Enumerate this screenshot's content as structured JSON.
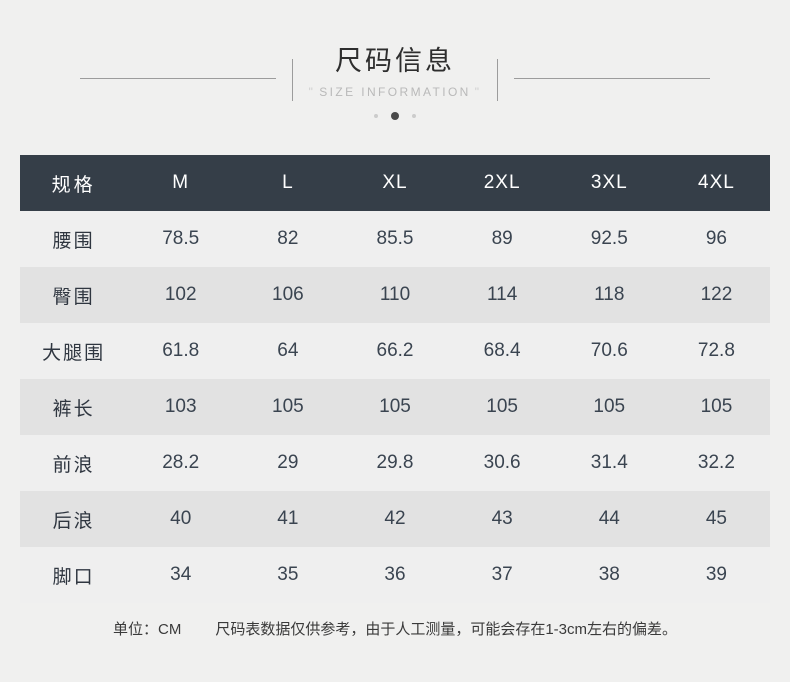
{
  "header": {
    "title": "尺码信息",
    "subtitle": "SIZE INFORMATION",
    "quote_open": "\"",
    "quote_close": "\"",
    "accent_color": "#353e48",
    "rule_color": "#9c9c9c",
    "dots": [
      {
        "name": "carousel-dot-1",
        "active": false
      },
      {
        "name": "carousel-dot-2",
        "active": true
      },
      {
        "name": "carousel-dot-3",
        "active": false
      }
    ]
  },
  "table": {
    "columns": [
      "规格",
      "M",
      "L",
      "XL",
      "2XL",
      "3XL",
      "4XL"
    ],
    "rows": [
      {
        "label": "腰围",
        "values": [
          "78.5",
          "82",
          "85.5",
          "89",
          "92.5",
          "96"
        ]
      },
      {
        "label": "臀围",
        "values": [
          "102",
          "106",
          "110",
          "114",
          "118",
          "122"
        ]
      },
      {
        "label": "大腿围",
        "values": [
          "61.8",
          "64",
          "66.2",
          "68.4",
          "70.6",
          "72.8"
        ]
      },
      {
        "label": "裤长",
        "values": [
          "103",
          "105",
          "105",
          "105",
          "105",
          "105"
        ]
      },
      {
        "label": "前浪",
        "values": [
          "28.2",
          "29",
          "29.8",
          "30.6",
          "31.4",
          "32.2"
        ]
      },
      {
        "label": "后浪",
        "values": [
          "40",
          "41",
          "42",
          "43",
          "44",
          "45"
        ]
      },
      {
        "label": "脚口",
        "values": [
          "34",
          "35",
          "36",
          "37",
          "38",
          "39"
        ]
      }
    ],
    "header_bg": "#353e48",
    "band_a": "#efefef",
    "band_b": "#e2e2e2"
  },
  "footer": {
    "unit_label": "单位：CM",
    "disclaimer": "尺码表数据仅供参考，由于人工测量，可能会存在1-3cm左右的偏差。"
  }
}
